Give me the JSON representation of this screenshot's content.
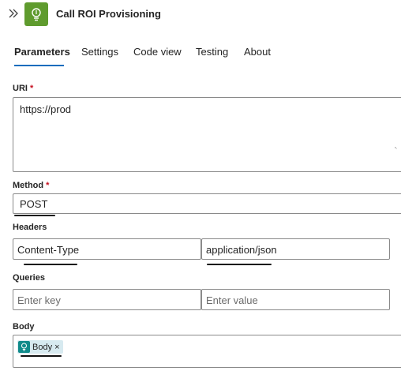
{
  "header": {
    "collapse_icon": "double-chevron-right-icon",
    "app_icon": "lightbulb-icon",
    "app_icon_color": "#5f9b2e",
    "title": "Call ROI Provisioning"
  },
  "tabs": [
    {
      "label": "Parameters",
      "active": true
    },
    {
      "label": "Settings",
      "active": false
    },
    {
      "label": "Code view",
      "active": false
    },
    {
      "label": "Testing",
      "active": false
    },
    {
      "label": "About",
      "active": false
    }
  ],
  "accent_color": "#0f6cbd",
  "required_color": "#c50f1f",
  "form": {
    "uri": {
      "label": "URI",
      "required_mark": "*",
      "value": "https://prod"
    },
    "method": {
      "label": "Method",
      "required_mark": "*",
      "value": "POST"
    },
    "headers": {
      "label": "Headers",
      "key": "Content-Type",
      "value": "application/json"
    },
    "queries": {
      "label": "Queries",
      "key_placeholder": "Enter key",
      "value_placeholder": "Enter value"
    },
    "body": {
      "label": "Body",
      "token": {
        "label": "Body",
        "icon": "lightbulb-icon",
        "color": "#0f8a8a",
        "close": "×"
      }
    }
  }
}
